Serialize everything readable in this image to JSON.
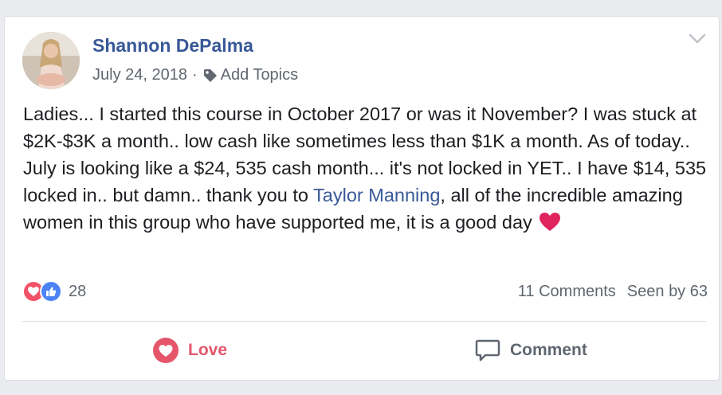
{
  "post": {
    "author": "Shannon DePalma",
    "date": "July 24, 2018",
    "separator": "·",
    "add_topics": "Add Topics",
    "text_before_mention": "Ladies... I started this course in October 2017 or was it November? I was stuck at $2K-$3K a month.. low cash like sometimes less than $1K a month. As of today.. July is looking like a $24, 535 cash month... it's not locked in YET.. I have $14, 535 locked in.. but damn.. thank you to ",
    "mention": "Taylor Manning",
    "text_after_mention": ", all of the incredible amazing women in this group who have supported me, it is a good day "
  },
  "reactions": {
    "count": "28",
    "types": [
      "love-icon",
      "like-icon"
    ]
  },
  "stats": {
    "comments": "11 Comments",
    "seen": "Seen by 63"
  },
  "actions": {
    "love": "Love",
    "comment": "Comment"
  },
  "colors": {
    "link": "#385898",
    "love": "#e5566b",
    "like": "#4c84f5",
    "meta": "#606770"
  }
}
